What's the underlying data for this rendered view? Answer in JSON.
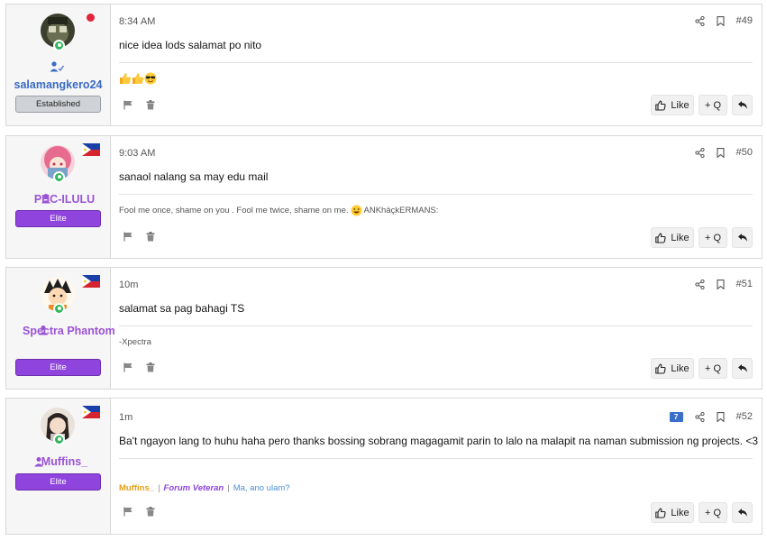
{
  "posts": [
    {
      "username": "salamangkero24",
      "rank": "Established",
      "time": "8:34 AM",
      "number": "#49",
      "message": "nice idea lods salamat po nito",
      "signature_emojis": [
        "thumbs-up",
        "thumbs-up",
        "sunglasses-face"
      ],
      "like_label": "Like",
      "quote_label": "+ Q"
    },
    {
      "username": "PHC-ILULU",
      "rank": "Elite",
      "time": "9:03 AM",
      "number": "#50",
      "message": "sanaol nalang sa may edu mail",
      "signature_text": "Fool me once, shame on you . Fool me twice, shame on me.",
      "signature_suffix": "ANKhäçkERMANS:",
      "like_label": "Like",
      "quote_label": "+ Q"
    },
    {
      "username": "Spectra Phantom",
      "rank": "Elite",
      "time": "10m",
      "number": "#51",
      "message": "salamat sa pag bahagi TS",
      "signature_text": "-Xpectra",
      "like_label": "Like",
      "quote_label": "+ Q"
    },
    {
      "username": "Muffins_",
      "rank": "Elite",
      "time": "1m",
      "number": "#52",
      "message": "Ba't ngayon lang to huhu haha pero thanks bossing sobrang magagamit parin to lalo na malapit na naman submission ng projects. <3",
      "signature_name": "Muffins_",
      "signature_rank": "Forum Veteran",
      "signature_sep": "|",
      "signature_link": "Ma, ano ulam?",
      "badge": "7",
      "like_label": "Like",
      "quote_label": "+ Q"
    }
  ],
  "colors": {
    "username_blue": "#3a6bc5",
    "username_purple": "#9b52d5",
    "elite_badge": "#8f44dd",
    "online": "#2fb65a",
    "status_red": "#e0263b"
  },
  "icons": [
    "share-icon",
    "bookmark-icon",
    "flag-icon",
    "trash-icon",
    "thumbs-up-icon",
    "reply-icon",
    "user-icon",
    "philippines-flag-icon",
    "online-status-icon"
  ]
}
